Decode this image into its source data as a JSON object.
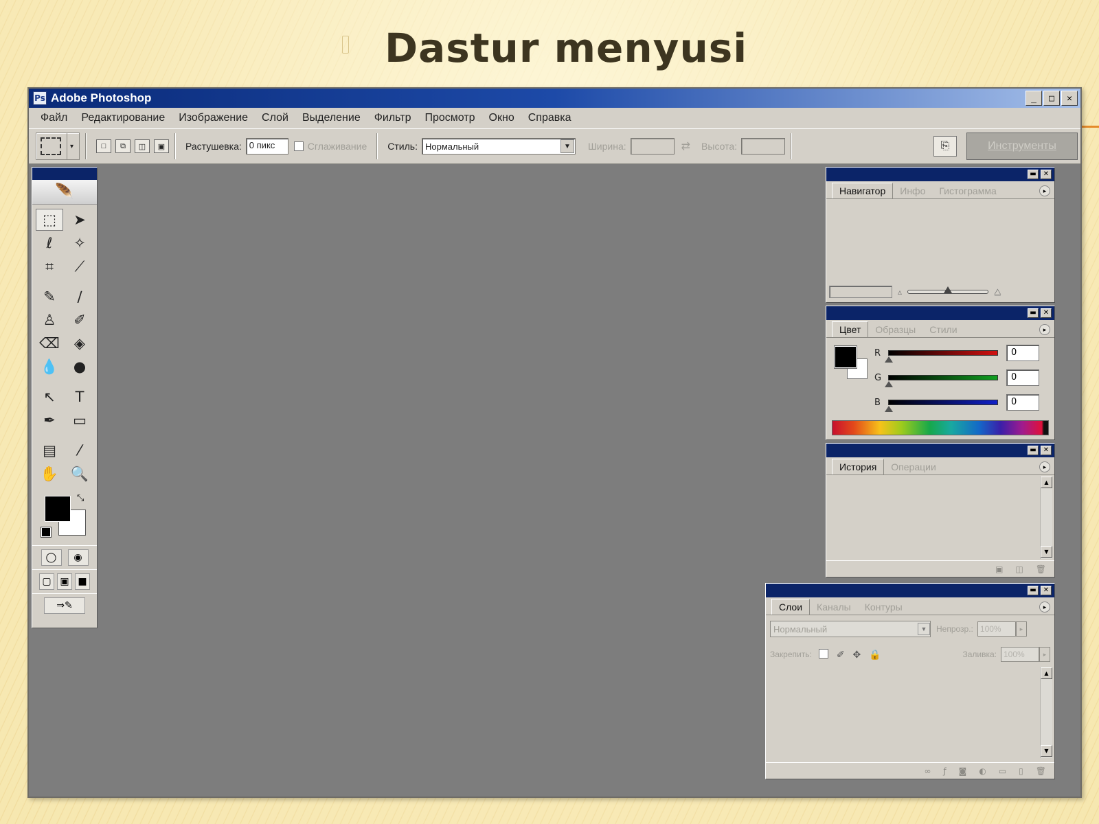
{
  "slide": {
    "title": "Dastur menyusi"
  },
  "window": {
    "title": "Adobe Photoshop",
    "controls": [
      "_",
      "□",
      "✕"
    ]
  },
  "menu": [
    "Файл",
    "Редактирование",
    "Изображение",
    "Слой",
    "Выделение",
    "Фильтр",
    "Просмотр",
    "Окно",
    "Справка"
  ],
  "options": {
    "feather_label": "Растушевка:",
    "feather_value": "0 пикс",
    "antialias_label": "Сглаживание",
    "style_label": "Стиль:",
    "style_value": "Нормальный",
    "width_label": "Ширина:",
    "height_label": "Высота:",
    "palette_well_label": "Инструменты"
  },
  "toolbox": {
    "tools": [
      {
        "name": "rectangular-marquee-tool-icon",
        "glyph": "⬚"
      },
      {
        "name": "move-tool-icon",
        "glyph": "➤"
      },
      {
        "name": "lasso-tool-icon",
        "glyph": "ℓ"
      },
      {
        "name": "magic-wand-tool-icon",
        "glyph": "✧"
      },
      {
        "name": "crop-tool-icon",
        "glyph": "⌗"
      },
      {
        "name": "slice-tool-icon",
        "glyph": "⟋"
      },
      {
        "name": "healing-brush-tool-icon",
        "glyph": "✎"
      },
      {
        "name": "brush-tool-icon",
        "glyph": "∕"
      },
      {
        "name": "clone-stamp-tool-icon",
        "glyph": "♙"
      },
      {
        "name": "history-brush-tool-icon",
        "glyph": "✐"
      },
      {
        "name": "eraser-tool-icon",
        "glyph": "⌫"
      },
      {
        "name": "paint-bucket-tool-icon",
        "glyph": "◈"
      },
      {
        "name": "blur-tool-icon",
        "glyph": "💧"
      },
      {
        "name": "dodge-tool-icon",
        "glyph": "●"
      },
      {
        "name": "path-selection-tool-icon",
        "glyph": "↖"
      },
      {
        "name": "type-tool-icon",
        "glyph": "T"
      },
      {
        "name": "pen-tool-icon",
        "glyph": "✒"
      },
      {
        "name": "shape-tool-icon",
        "glyph": "▭"
      },
      {
        "name": "notes-tool-icon",
        "glyph": "▤"
      },
      {
        "name": "eyedropper-tool-icon",
        "glyph": "⁄"
      },
      {
        "name": "hand-tool-icon",
        "glyph": "✋"
      },
      {
        "name": "zoom-tool-icon",
        "glyph": "🔍"
      }
    ]
  },
  "navigator": {
    "tabs": [
      "Навигатор",
      "Инфо",
      "Гистограмма"
    ]
  },
  "color": {
    "tabs": [
      "Цвет",
      "Образцы",
      "Стили"
    ],
    "channels": [
      {
        "label": "R",
        "value": "0",
        "color": "#d11010"
      },
      {
        "label": "G",
        "value": "0",
        "color": "#10a020"
      },
      {
        "label": "B",
        "value": "0",
        "color": "#1020c8"
      }
    ]
  },
  "history": {
    "tabs": [
      "История",
      "Операции"
    ]
  },
  "layers": {
    "tabs": [
      "Слои",
      "Каналы",
      "Контуры"
    ],
    "blend_mode": "Нормальный",
    "opacity_label": "Непрозр.:",
    "opacity_value": "100%",
    "lock_label": "Закрепить:",
    "fill_label": "Заливка:",
    "fill_value": "100%"
  },
  "colors": {
    "titlebar": "#0a2a78",
    "workspace": "#7d7d7d",
    "chrome": "#d4d0c8"
  }
}
